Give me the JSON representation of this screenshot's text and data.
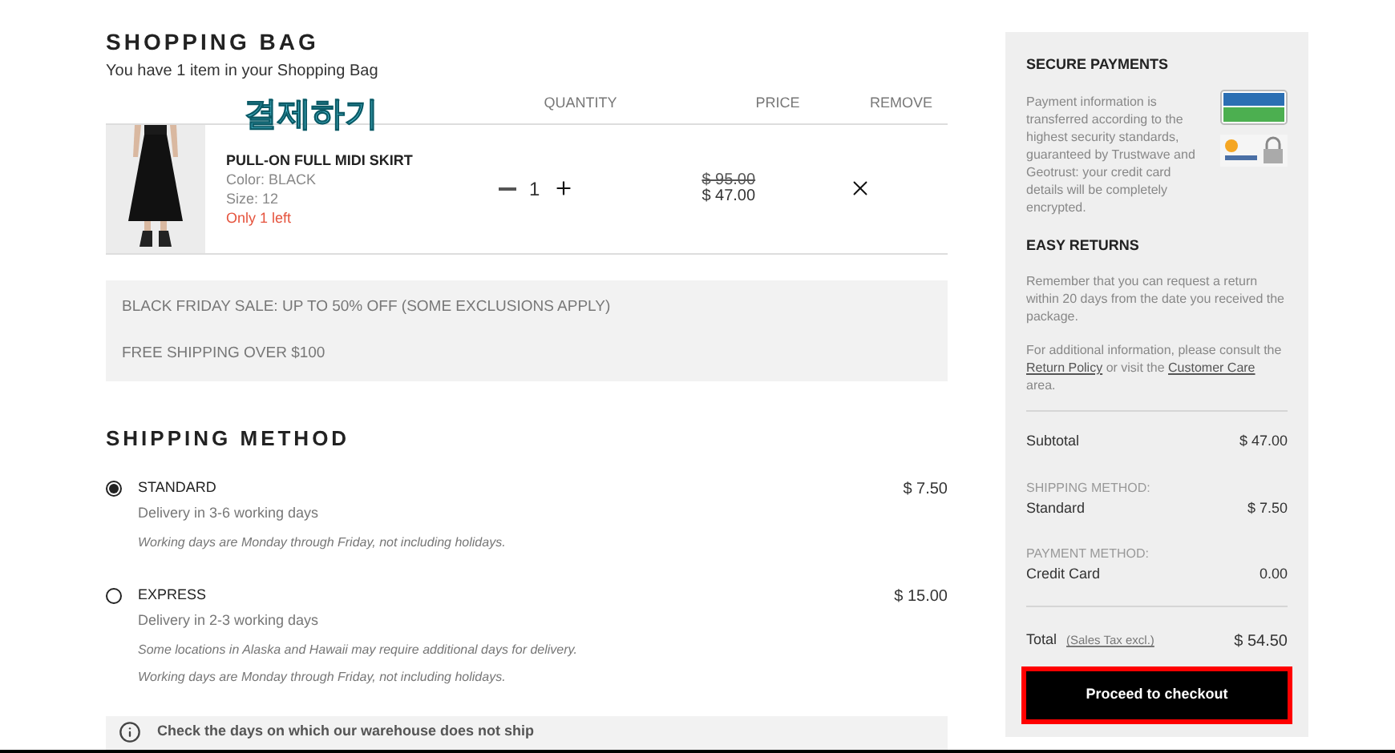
{
  "cart": {
    "title": "SHOPPING BAG",
    "subtitle": "You have 1 item in your Shopping Bag",
    "overlay_label": "결제하기",
    "columns": [
      "QUANTITY",
      "PRICE",
      "REMOVE"
    ],
    "items": [
      {
        "name": "PULL-ON FULL MIDI SKIRT",
        "details": [
          "Color:  BLACK",
          "Size: 12"
        ],
        "stock": "Only 1 left",
        "quantity": "1",
        "old_price": "$ 95.00",
        "price": "$ 47.00"
      }
    ]
  },
  "promo": [
    "BLACK FRIDAY SALE: UP TO 50% OFF (SOME EXCLUSIONS APPLY)",
    "FREE SHIPPING OVER $100"
  ],
  "shipping": {
    "title": "SHIPPING METHOD",
    "options": [
      {
        "name": "STANDARD",
        "selected": true,
        "price": "$ 7.50",
        "delivery": "Delivery in 3-6 working days",
        "notes": [
          "Working days are Monday through Friday, not including holidays."
        ]
      },
      {
        "name": "EXPRESS",
        "selected": false,
        "price": "$ 15.00",
        "delivery": "Delivery in 2-3 working days",
        "notes": [
          "Some locations in Alaska and Hawaii may require additional days for delivery.",
          "Working days are Monday through Friday, not including holidays."
        ]
      }
    ]
  },
  "notice": {
    "text": "Check the days on which our warehouse does not ship"
  },
  "sidebar": {
    "secure": {
      "title": "SECURE PAYMENTS",
      "text": "Payment information is transferred according to the highest security standards, guaranteed by Trustwave and Geotrust: your credit card details will be completely encrypted."
    },
    "returns": {
      "title": "EASY RETURNS",
      "text": "Remember that you can request a return within 20 days from the date you received the package.",
      "more_before": "For additional information, please consult the",
      "link_1": "Return Policy",
      "more_middle": "or visit the",
      "link_2": "Customer Care",
      "more_after": "area."
    },
    "summary": [
      {
        "label": "Subtotal",
        "value": "$ 47.00"
      },
      {
        "caption": "SHIPPING METHOD:",
        "label": "Standard",
        "value": "$ 7.50"
      },
      {
        "caption": "PAYMENT METHOD:",
        "label": "Credit Card",
        "value": "0.00"
      }
    ],
    "total": {
      "label": "Total",
      "note": "(Sales Tax excl.)",
      "value": "$ 54.50"
    },
    "checkout": {
      "label": "Proceed to checkout",
      "highlighted": true
    }
  }
}
